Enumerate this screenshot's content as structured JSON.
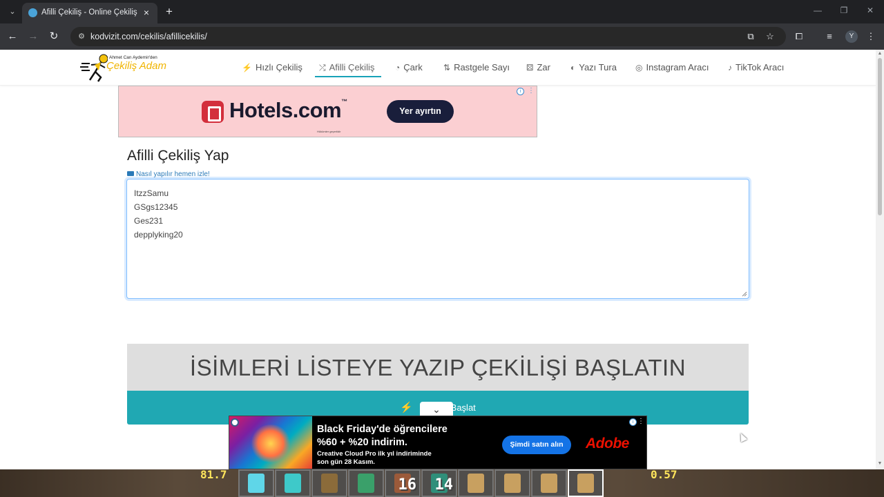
{
  "browser": {
    "tab_title": "Afilli Çekiliş - Online Çekiliş - Hı",
    "new_tab_symbol": "+",
    "url": "kodvizit.com/cekilis/afillicekilis/",
    "profile_initial": "Y"
  },
  "site": {
    "logo_small": "Ahmet Can Aydemir'den",
    "logo_big": "Çekiliş Adam",
    "nav": [
      {
        "label": "Hızlı Çekiliş",
        "icon": "⚡",
        "icon_name": "bolt-icon"
      },
      {
        "label": "Afilli Çekiliş",
        "icon": "⤮",
        "icon_name": "shuffle-icon"
      },
      {
        "label": "Çark",
        "icon": "◔",
        "icon_name": "wheel-icon"
      },
      {
        "label": "Rastgele Sayı",
        "icon": "⇅",
        "icon_name": "sort-icon"
      },
      {
        "label": "Zar",
        "icon": "⚄",
        "icon_name": "dice-icon"
      },
      {
        "label": "Yazı Tura",
        "icon": "◐",
        "icon_name": "coin-icon"
      },
      {
        "label": "Instagram Aracı",
        "icon": "◎",
        "icon_name": "instagram-icon"
      },
      {
        "label": "TikTok Aracı",
        "icon": "♪",
        "icon_name": "tiktok-icon"
      }
    ],
    "active_nav": "Afilli Çekiliş"
  },
  "ad_top": {
    "brand": "Hotels.com",
    "tm": "™",
    "button": "Yer ayırtın",
    "fine_print": "Hükümler geçerlidir",
    "bg_color": "#fbcfd2"
  },
  "main": {
    "title": "Afilli Çekiliş Yap",
    "howto_link": "Nasıl yapılır hemen izle!",
    "names": [
      "ItzzSamu",
      "GSgs12345",
      "Ges231",
      "depplyking20"
    ],
    "banner_text": "İSİMLERİ LİSTEYE YAZIP ÇEKİLİŞİ BAŞLATIN",
    "start_button": "Çekilişi Başlat",
    "accent_color": "#20a8b3"
  },
  "ad_bottom": {
    "headline_1": "Black Friday'de öğrencilere",
    "headline_2": "%60 + %20 indirim.",
    "sub_1": "Creative Cloud Pro ilk yıl indiriminde",
    "sub_2": "son gün 28 Kasım.",
    "button": "Şimdi satın alın",
    "brand": "Adobe"
  },
  "game": {
    "left_num": "81.7",
    "right_num": "0.57",
    "slots": [
      {
        "count": "",
        "color": "#5fd6e8"
      },
      {
        "count": "",
        "color": "#3ec9c9"
      },
      {
        "count": "",
        "color": "#8b6b3a"
      },
      {
        "count": "",
        "color": "#3aa06a"
      },
      {
        "count": "16",
        "color": "#9b5a3a"
      },
      {
        "count": "14",
        "color": "#2f8f7a"
      },
      {
        "count": "",
        "color": "#c8a060"
      },
      {
        "count": "",
        "color": "#c8a060"
      },
      {
        "count": "",
        "color": "#c8a060"
      },
      {
        "count": "",
        "color": "#c8a060"
      }
    ]
  }
}
